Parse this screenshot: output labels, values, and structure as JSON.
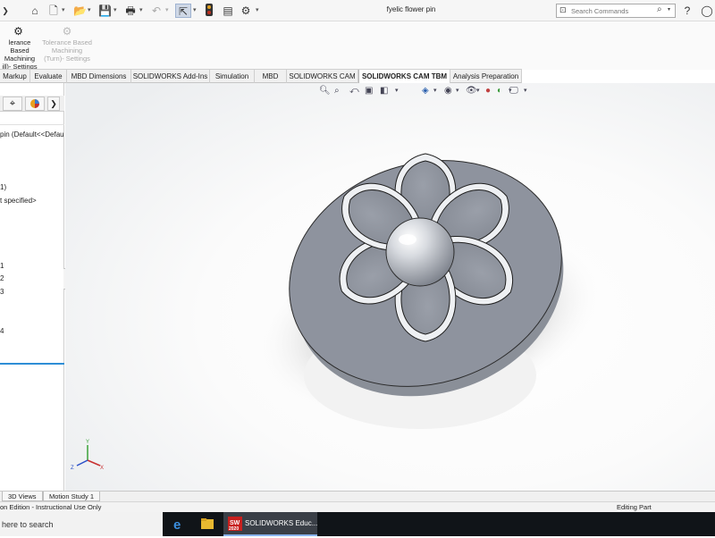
{
  "window": {
    "title": "fyelic flower pin"
  },
  "titlebar": {
    "icons": [
      "home-icon",
      "new-file-icon",
      "open-icon",
      "save-icon",
      "print-icon",
      "undo-icon",
      "select-arrow-icon",
      "rebuild-icon",
      "file-properties-icon",
      "options-gear-icon"
    ],
    "search_placeholder": "Search Commands"
  },
  "commandmanager": {
    "buttons": [
      {
        "label_lines": [
          "Tolerance Based",
          "Machining",
          "(Mill)- Settings"
        ],
        "visible_text": [
          "lerance Based",
          "Machining",
          "ill)- Settings"
        ],
        "enabled": true,
        "icon": "gear-icon"
      },
      {
        "label_lines": [
          "Tolerance Based",
          "Machining",
          "(Turn)- Settings"
        ],
        "visible_text": [
          "Tolerance Based",
          "Machining",
          "(Turn)- Settings"
        ],
        "enabled": false,
        "icon": "gear-icon"
      }
    ]
  },
  "tabs": [
    {
      "label": "Markup",
      "active": false
    },
    {
      "label": "Evaluate",
      "active": false
    },
    {
      "label": "MBD Dimensions",
      "active": false
    },
    {
      "label": "SOLIDWORKS Add-Ins",
      "active": false
    },
    {
      "label": "Simulation",
      "active": false
    },
    {
      "label": "MBD",
      "active": false
    },
    {
      "label": "SOLIDWORKS CAM",
      "active": false
    },
    {
      "label": "SOLIDWORKS CAM TBM",
      "active": true
    },
    {
      "label": "Analysis Preparation",
      "active": false
    }
  ],
  "feature_tree": {
    "rows": [
      "pin  (Default<<Defau",
      "1)",
      "t specified>",
      "1",
      "2",
      "3",
      "4"
    ]
  },
  "bottom_tabs": [
    "3D Views",
    "Motion Study 1"
  ],
  "status": {
    "left": "on Edition - Instructional Use Only",
    "right": "Editing Part"
  },
  "taskbar": {
    "search": "here to search",
    "app_label": "SOLIDWORKS Educ...",
    "app_badge": "2020"
  },
  "colors": {
    "active_tab_bg": "#ffffff",
    "tree_highlight": "#2e8ed6",
    "part_gray": "#8e939e",
    "taskbar": "#101418"
  }
}
